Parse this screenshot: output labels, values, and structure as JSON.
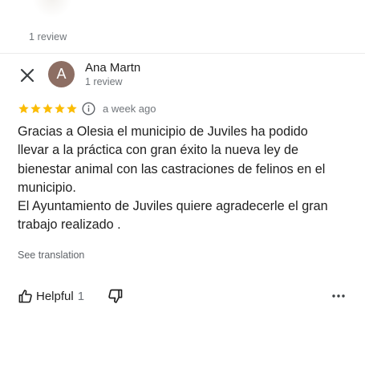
{
  "previous_review": {
    "review_count_text": "1 review",
    "close_icon": "close-icon"
  },
  "review": {
    "avatar_letter": "A",
    "avatar_color": "#8d6e63",
    "author_name": "Ana Martn",
    "author_review_count": "1 review",
    "rating": 5,
    "rating_max": 5,
    "star_color": "#fbbc04",
    "time_ago": "a week ago",
    "text": "Gracias a Olesia el municipio de Juviles ha podido\nllevar a la práctica con gran éxito la nueva ley de\nbienestar animal con las castraciones de felinos en el\nmunicipio.\nEl Ayuntamiento de Juviles quiere agradecerle el gran\ntrabajo realizado .",
    "see_translation_label": "See translation",
    "helpful_label": "Helpful",
    "helpful_count": "1",
    "icons": {
      "close": "close-icon",
      "info": "info-icon",
      "helpful": "thumb-up-icon",
      "dislike": "thumb-down-icon",
      "more": "more-horizontal-icon"
    }
  }
}
